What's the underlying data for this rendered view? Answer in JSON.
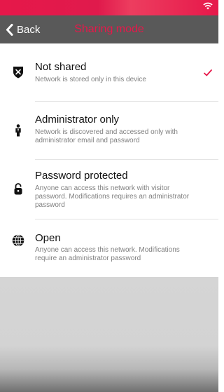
{
  "colors": {
    "accent": "#e6184a",
    "nav_background": "#595959",
    "check": "#e6184a"
  },
  "status_bar": {
    "icons": [
      "wifi-icon"
    ]
  },
  "nav": {
    "back_label": "Back",
    "title": "Sharing mode",
    "back_icon": "chevron-left-icon"
  },
  "options": [
    {
      "icon": "shield-x-icon",
      "title": "Not shared",
      "description": "Network is stored only in this device",
      "selected": true
    },
    {
      "icon": "person-icon",
      "title": "Administrator only",
      "description": "Network is discovered and accessed only with administrator email and password",
      "selected": false
    },
    {
      "icon": "padlock-icon",
      "title": "Password protected",
      "description": "Anyone can access this network with visitor password. Modifications requires an administrator password",
      "selected": false
    },
    {
      "icon": "globe-icon",
      "title": "Open",
      "description": "Anyone can access this network. Modifications require an administrator password",
      "selected": false
    }
  ]
}
